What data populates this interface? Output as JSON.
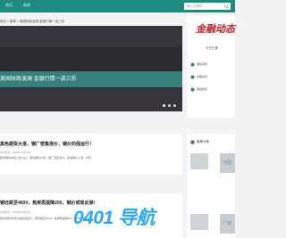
{
  "nav": {
    "items": [
      "首页",
      "新闻"
    ],
    "search_placeholder": "输入关键词"
  },
  "breadcrumb": "首页 > 新闻 > 美国财政波澜 金银行情一波三折",
  "hero": {
    "title": "美国财政波澜 金银行情一波三折"
  },
  "articles": [
    {
      "title": "黑色期货大涨，钢厂密集涨价，钢价的强运行！",
      "meta": "新闻资讯  ·  2025年11月06日",
      "summary": "国内钢材市场上涨为主，黑色期货大涨，钢厂密集涨价，多地钢价上调，市场"
    },
    {
      "title": "钢坯跌至4600，焦炭再提降200，钢价或现反弹！",
      "meta": "新闻资讯  ·  2025年11月06日",
      "summary": "国内钢材市场价格震荡运行，钢坯跌至4600，焦炭再提降200，市场观望为主"
    }
  ],
  "sidebar": {
    "logo_text": "金融动态",
    "logo_sub": "今日已更",
    "links": [
      "国际资讯",
      "中国资讯",
      "财经资讯"
    ],
    "heading": "推荐头条",
    "items": [
      "中国",
      "广西"
    ]
  },
  "watermark": "0401 导航",
  "colors": {
    "nav_bg": "#1d8c80",
    "hero_bar": "#35827d",
    "logo_red": "#c0212a",
    "watermark": "#29a8ff"
  }
}
